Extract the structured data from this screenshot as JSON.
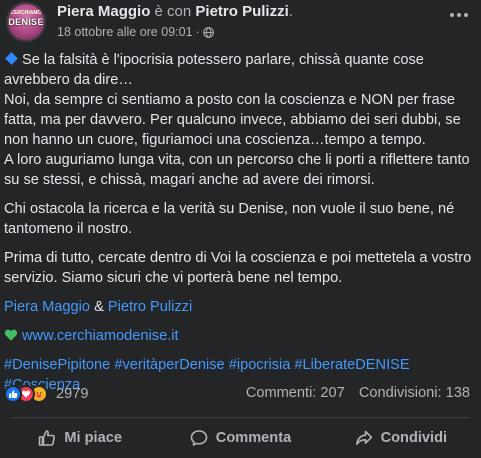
{
  "post": {
    "author": "Piera Maggio",
    "with_text": "è con",
    "tagged": "Pietro Pulizzi",
    "timestamp": "18 ottobre alle ore 09:01",
    "dot": "·",
    "avatar_text": "DENISE",
    "avatar_small_text": "CERCHIAMO",
    "paragraphs": {
      "p1_line1": "Se la falsità è l'ipocrisia potessero parlare, chissà quante cose avrebbero da dire…",
      "p1_line2": "Noi, da sempre ci sentiamo a posto con la coscienza e NON per frase fatta, ma per davvero. Per qualcuno invece, abbiamo dei seri dubbi, se non hanno un cuore, figuriamoci una coscienza…tempo a tempo.",
      "p1_line3": "A loro auguriamo lunga vita, con un percorso che li porti a riflettere tanto su se stessi, e chissà, magari anche ad avere dei rimorsi.",
      "p2": "Chi ostacola la ricerca e la verità su Denise, non vuole il suo bene, né tantomeno il nostro.",
      "p3": "Prima di tutto, cercate dentro di Voi la coscienza e poi mettetela a vostro servizio. Siamo sicuri che vi porterà bene nel tempo."
    },
    "signature": {
      "name1": "Piera Maggio",
      "amp": "&",
      "name2": "Pietro Pulizzi"
    },
    "website": "www.cerchiamodenise.it",
    "hashtags_line1": "#DenisePipitone #veritàperDenise #ipocrisia #LiberateDENISE",
    "hashtags_line2": "#Coscienza",
    "reaction_count": "2979",
    "comments": "Commenti: 207",
    "shares": "Condivisioni: 138"
  },
  "actions": {
    "like": "Mi piace",
    "comment": "Commenta",
    "share": "Condividi"
  },
  "colors": {
    "background": "#242526",
    "text": "#e4e6eb",
    "secondary": "#b0b3b8",
    "link": "#4599ff",
    "like_blue": "#1877f2",
    "love_red": "#f33e58",
    "heart_green": "#45bd62"
  }
}
